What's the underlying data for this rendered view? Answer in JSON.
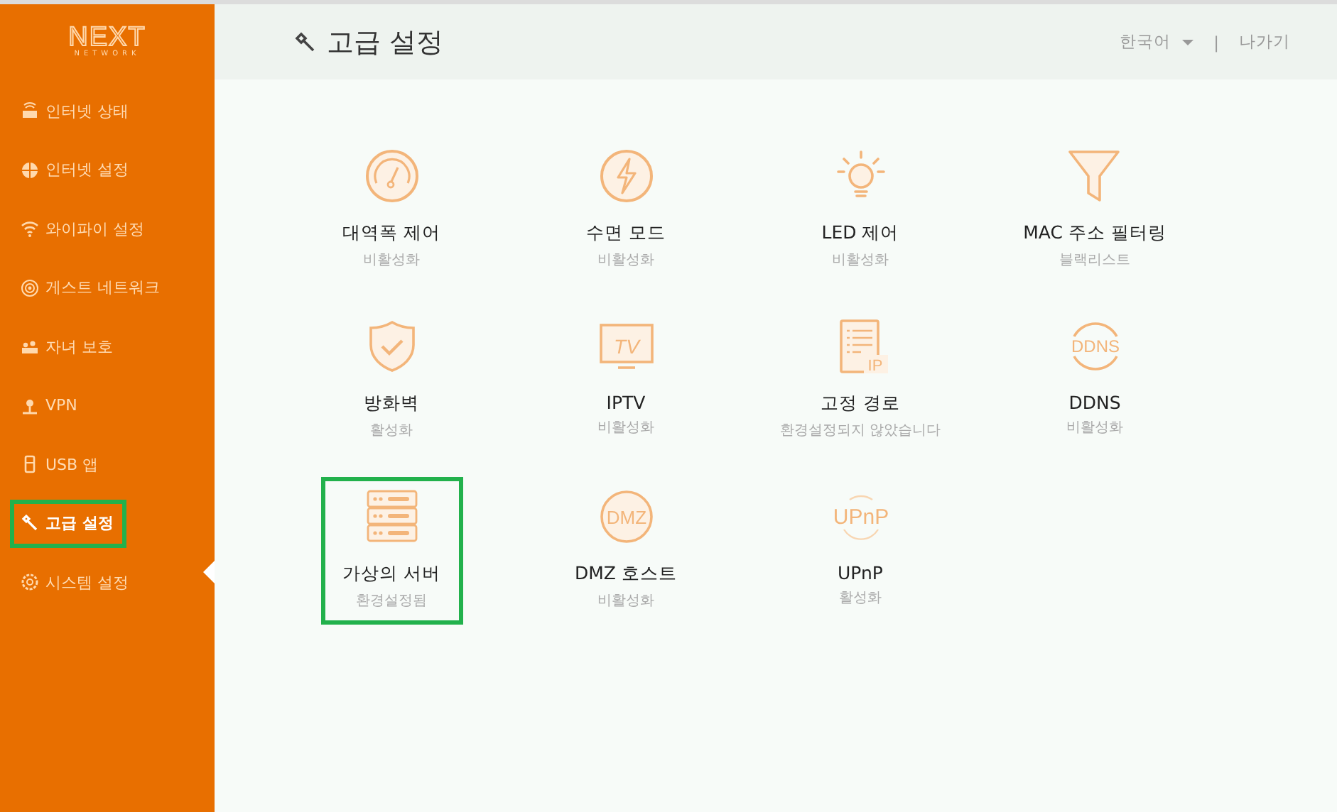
{
  "logo": {
    "name": "NEXT",
    "tagline": "NETWORK"
  },
  "sidebar": {
    "items": [
      {
        "label": "인터넷 상태",
        "selected": false,
        "highlighted": false
      },
      {
        "label": "인터넷 설정",
        "selected": false,
        "highlighted": false
      },
      {
        "label": "와이파이 설정",
        "selected": false,
        "highlighted": false
      },
      {
        "label": "게스트 네트워크",
        "selected": false,
        "highlighted": false
      },
      {
        "label": "자녀 보호",
        "selected": false,
        "highlighted": false
      },
      {
        "label": "VPN",
        "selected": false,
        "highlighted": false
      },
      {
        "label": "USB 앱",
        "selected": false,
        "highlighted": false
      },
      {
        "label": "고급 설정",
        "selected": true,
        "highlighted": true
      },
      {
        "label": "시스템 설정",
        "selected": false,
        "highlighted": false
      }
    ]
  },
  "header": {
    "title": "고급 설정",
    "language": "한국어",
    "separator": "|",
    "logout": "나가기"
  },
  "tiles": [
    {
      "title": "대역폭 제어",
      "status": "비활성화",
      "highlighted": false
    },
    {
      "title": "수면 모드",
      "status": "비활성화",
      "highlighted": false
    },
    {
      "title": "LED 제어",
      "status": "비활성화",
      "highlighted": false
    },
    {
      "title": "MAC 주소 필터링",
      "status": "블랙리스트",
      "highlighted": false
    },
    {
      "title": "방화벽",
      "status": "활성화",
      "highlighted": false
    },
    {
      "title": "IPTV",
      "status": "비활성화",
      "icon_text": "TV",
      "highlighted": false
    },
    {
      "title": "고정 경로",
      "status": "환경설정되지 않았습니다",
      "icon_text": "IP",
      "highlighted": false
    },
    {
      "title": "DDNS",
      "status": "비활성화",
      "icon_text": "DDNS",
      "highlighted": false
    },
    {
      "title": "가상의 서버",
      "status": "환경설정됨",
      "highlighted": true
    },
    {
      "title": "DMZ 호스트",
      "status": "비활성화",
      "icon_text": "DMZ",
      "highlighted": false
    },
    {
      "title": "UPnP",
      "status": "활성화",
      "icon_text": "UPnP",
      "highlighted": false
    }
  ]
}
